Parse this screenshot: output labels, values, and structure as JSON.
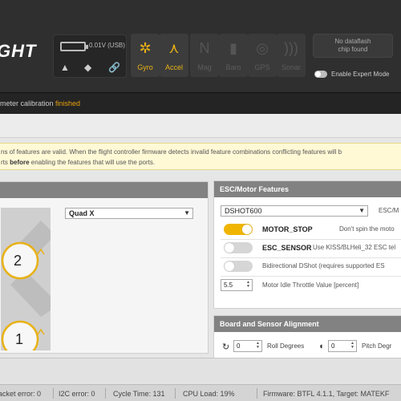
{
  "header": {
    "logo_fragment": "GHT",
    "battery_text": "0.01V (USB)",
    "sensors": [
      {
        "label": "Gyro",
        "icon": "gyro-icon",
        "active": true
      },
      {
        "label": "Accel",
        "icon": "accel-icon",
        "active": true
      },
      {
        "label": "Mag",
        "icon": "mag-icon",
        "active": false
      },
      {
        "label": "Baro",
        "icon": "baro-icon",
        "active": false
      },
      {
        "label": "GPS",
        "icon": "gps-icon",
        "active": false
      },
      {
        "label": "Sonar",
        "icon": "sonar-icon",
        "active": false
      }
    ],
    "dataflash_line1": "No dataflash",
    "dataflash_line2": "chip found",
    "expert_mode_label": "Enable Expert Mode",
    "accent_color": "#e8b116"
  },
  "status": {
    "prefix": "meter calibration ",
    "highlight": "finished"
  },
  "note": {
    "line1": "ns of features are valid. When the flight controller firmware detects invalid feature combinations conflicting features will b",
    "line2_prefix": "rts ",
    "line2_bold": "before",
    "line2_suffix": " enabling the features that will use the ports."
  },
  "mixer": {
    "selected": "Quad X",
    "motor_labels": [
      "2",
      "1"
    ]
  },
  "esc": {
    "title": "ESC/Motor Features",
    "protocol_selected": "DSHOT600",
    "protocol_label": "ESC/M",
    "motor_stop_name": "MOTOR_STOP",
    "motor_stop_desc": "Don't spin the moto",
    "motor_stop_on": true,
    "esc_sensor_name": "ESC_SENSOR",
    "esc_sensor_desc": "Use KISS/BLHeli_32 ESC tel",
    "esc_sensor_on": false,
    "bidir_desc": "Bidirectional DShot (requires supported ES",
    "bidir_on": false,
    "idle_value": "5.5",
    "idle_label": "Motor Idle Throttle Value [percent]"
  },
  "board": {
    "title": "Board and Sensor Alignment",
    "roll_value": "0",
    "roll_label": "Roll Degrees",
    "pitch_value": "0",
    "pitch_label": "Pitch Degr"
  },
  "footer": {
    "packet_error": "acket error: 0",
    "i2c_error": "I2C error: 0",
    "cycle_time": "Cycle Time: 131",
    "cpu_load": "CPU Load: 19%",
    "firmware": "Firmware: BTFL 4.1.1, Target: MATEKF"
  }
}
